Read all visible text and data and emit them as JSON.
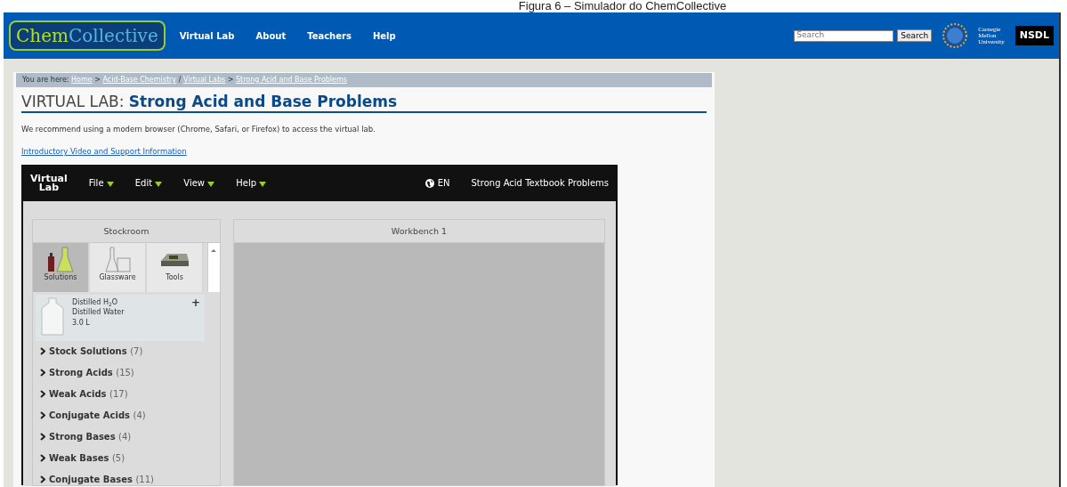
{
  "caption": "Figura 6 – Simulador do ChemCollective",
  "header": {
    "logo_parts": [
      "Chem",
      "Collective"
    ],
    "nav": [
      "Virtual Lab",
      "About",
      "Teachers",
      "Help"
    ],
    "search": {
      "placeholder": "Search",
      "button": "Search"
    },
    "university": [
      "Carnegie",
      "Mellon",
      "University"
    ],
    "library": "NSDL"
  },
  "breadcrumb": {
    "label": "You are here:",
    "items": [
      {
        "text": "Home",
        "sep": ">"
      },
      {
        "text": "Acid-Base Chemistry",
        "sep": "/"
      },
      {
        "text": "Virtual Labs",
        "sep": ">"
      },
      {
        "text": "Strong Acid and Base Problems"
      }
    ]
  },
  "title": {
    "prefix": "VIRTUAL LAB:",
    "name": "Strong Acid and Base Problems"
  },
  "notice": "We recommend using a modern browser (Chrome, Safari, or Firefox) to access the virtual lab.",
  "support_link": "Introductory Video and Support Information",
  "app": {
    "logo": [
      "Virtual",
      "Lab"
    ],
    "menus": [
      "File",
      "Edit",
      "View",
      "Help"
    ],
    "language": "EN",
    "problem": "Strong Acid Textbook Problems",
    "stockroom": {
      "title": "Stockroom",
      "tabs": [
        {
          "label": "Solutions",
          "kind": "solutions",
          "selected": true
        },
        {
          "label": "Glassware",
          "kind": "glassware",
          "selected": false
        },
        {
          "label": "Tools",
          "kind": "tools",
          "selected": false
        }
      ],
      "item": {
        "name": "Distilled H$_{2}$O",
        "description": "Distilled Water",
        "volume": "3.0 L",
        "add": "+"
      },
      "categories": [
        {
          "name": "Stock Solutions",
          "count": "(7)"
        },
        {
          "name": "Strong Acids",
          "count": "(15)"
        },
        {
          "name": "Weak Acids",
          "count": "(17)"
        },
        {
          "name": "Conjugate Acids",
          "count": "(4)"
        },
        {
          "name": "Strong Bases",
          "count": "(4)"
        },
        {
          "name": "Weak Bases",
          "count": "(5)"
        },
        {
          "name": "Conjugate Bases",
          "count": "(11)"
        }
      ]
    },
    "workbench": {
      "title": "Workbench 1"
    }
  }
}
